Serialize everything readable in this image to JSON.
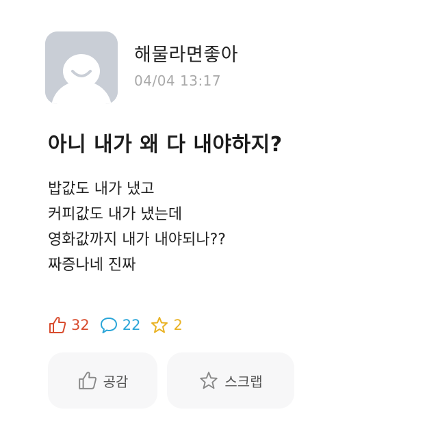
{
  "author": {
    "name": "해물라면좋아",
    "time": "04/04 13:17"
  },
  "post": {
    "title": "아니 내가 왜 다 내야하지?",
    "body_lines": [
      "밥값도 내가 냈고",
      "커피값도 내가 냈는데",
      "영화값까지 내가 내야되나??",
      "짜증나네 진짜"
    ]
  },
  "stats": {
    "likes": "32",
    "comments": "22",
    "scraps": "2"
  },
  "actions": {
    "like_label": "공감",
    "scrap_label": "스크랩"
  },
  "colors": {
    "like": "#d84c2e",
    "comment": "#2aa5d8",
    "scrap": "#e9b223",
    "avatar_bg": "#c9ced6",
    "button_bg": "#f7f7f8"
  },
  "icons": {
    "avatar": "default-avatar-icon",
    "like": "thumbs-up-icon",
    "comment": "speech-bubble-icon",
    "scrap": "star-icon"
  }
}
